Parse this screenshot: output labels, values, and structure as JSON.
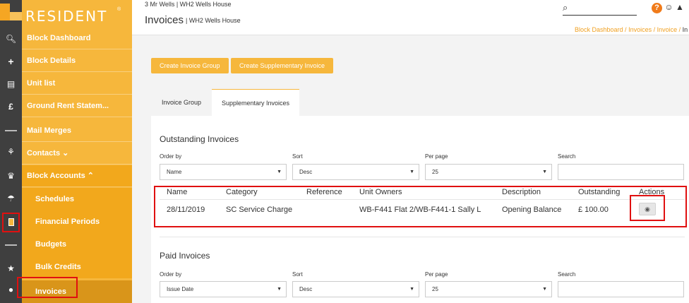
{
  "brand": {
    "name": "RESIDENT",
    "reg": "®"
  },
  "header": {
    "top_crumb": "3 Mr Wells | WH2 Wells House",
    "title": "Invoices",
    "subtitle": "| WH2 Wells House",
    "help_label": "?",
    "breadcrumb": [
      "Block Dashboard",
      "Invoices",
      "Invoice",
      "In"
    ]
  },
  "sidebar": {
    "items": [
      {
        "label": "Block Dashboard",
        "icon": "search-icon"
      },
      {
        "label": "Block Details",
        "icon": "plus-icon"
      },
      {
        "label": "Unit list",
        "icon": "briefcase-icon"
      },
      {
        "label": "Ground Rent Statem...",
        "icon": "pound-icon"
      },
      {
        "label": "Mail Merges",
        "icon": "dash-icon"
      },
      {
        "label": "Contacts ⌄",
        "icon": "contacts-icon"
      },
      {
        "label": "Block Accounts ⌃",
        "icon": "bank-icon"
      }
    ],
    "subitems": [
      {
        "label": "Schedules",
        "icon": "umbrella-icon"
      },
      {
        "label": "Financial Periods",
        "icon": "document-icon"
      },
      {
        "label": "Budgets",
        "icon": "dash-icon"
      },
      {
        "label": "Bulk Credits",
        "icon": "star-icon"
      },
      {
        "label": "Invoices",
        "icon": "bulb-icon"
      }
    ]
  },
  "actions": {
    "create_group": "Create Invoice Group",
    "create_supplementary": "Create Supplementary Invoice"
  },
  "tabs": [
    "Invoice Group",
    "Supplementary Invoices"
  ],
  "outstanding": {
    "title": "Outstanding Invoices",
    "filters": {
      "order_by_label": "Order by",
      "order_by_value": "Name",
      "sort_label": "Sort",
      "sort_value": "Desc",
      "per_page_label": "Per page",
      "per_page_value": "25",
      "search_label": "Search",
      "search_value": ""
    },
    "columns": [
      "Name",
      "Category",
      "Reference",
      "Unit Owners",
      "Description",
      "Outstanding",
      "Actions"
    ],
    "rows": [
      {
        "name": "28/11/2019",
        "category": "SC Service Charge",
        "reference": "",
        "unit_owners": "WB-F441 Flat 2/WB-F441-1 Sally L",
        "description": "Opening Balance",
        "outstanding": "£ 100.00",
        "action_icon": "eye-icon"
      }
    ]
  },
  "paid": {
    "title": "Paid Invoices",
    "filters": {
      "order_by_label": "Order by",
      "order_by_value": "Issue Date",
      "sort_label": "Sort",
      "sort_value": "Desc",
      "per_page_label": "Per page",
      "per_page_value": "25",
      "search_label": "Search",
      "search_value": ""
    }
  },
  "colors": {
    "accent": "#f6b73c",
    "sidebar": "#f6b73c",
    "rail": "#3f3f3f",
    "highlight": "#e01010",
    "help": "#f07b1a"
  }
}
